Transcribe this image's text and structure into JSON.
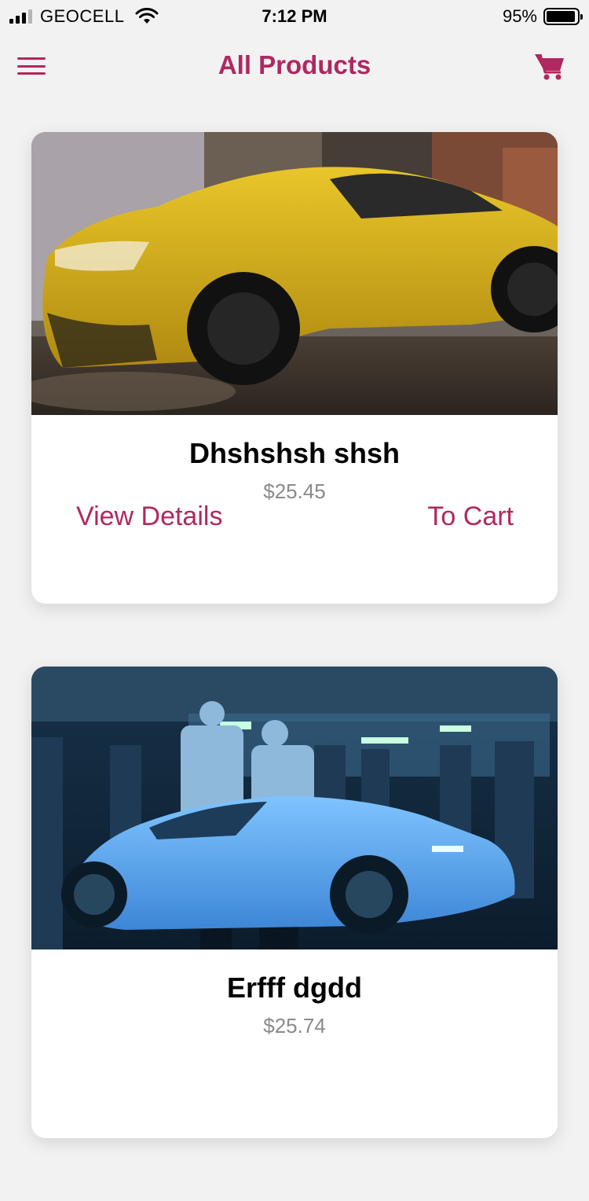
{
  "status_bar": {
    "carrier": "GEOCELL",
    "time": "7:12 PM",
    "battery": "95%",
    "battery_level": 0.95,
    "signal_bars": 3
  },
  "header": {
    "title": "All Products",
    "menu_icon": "hamburger-menu-icon",
    "cart_icon": "shopping-cart-icon"
  },
  "products": [
    {
      "name": "Dhshshsh shsh",
      "price": "$25.45",
      "view_details_label": "View Details",
      "to_cart_label": "To Cart"
    },
    {
      "name": "Erfff dgdd",
      "price": "$25.74"
    }
  ],
  "colors": {
    "accent": "#b0285f",
    "background": "#f2f2f2",
    "card": "#ffffff",
    "price": "#8a8a8a"
  }
}
